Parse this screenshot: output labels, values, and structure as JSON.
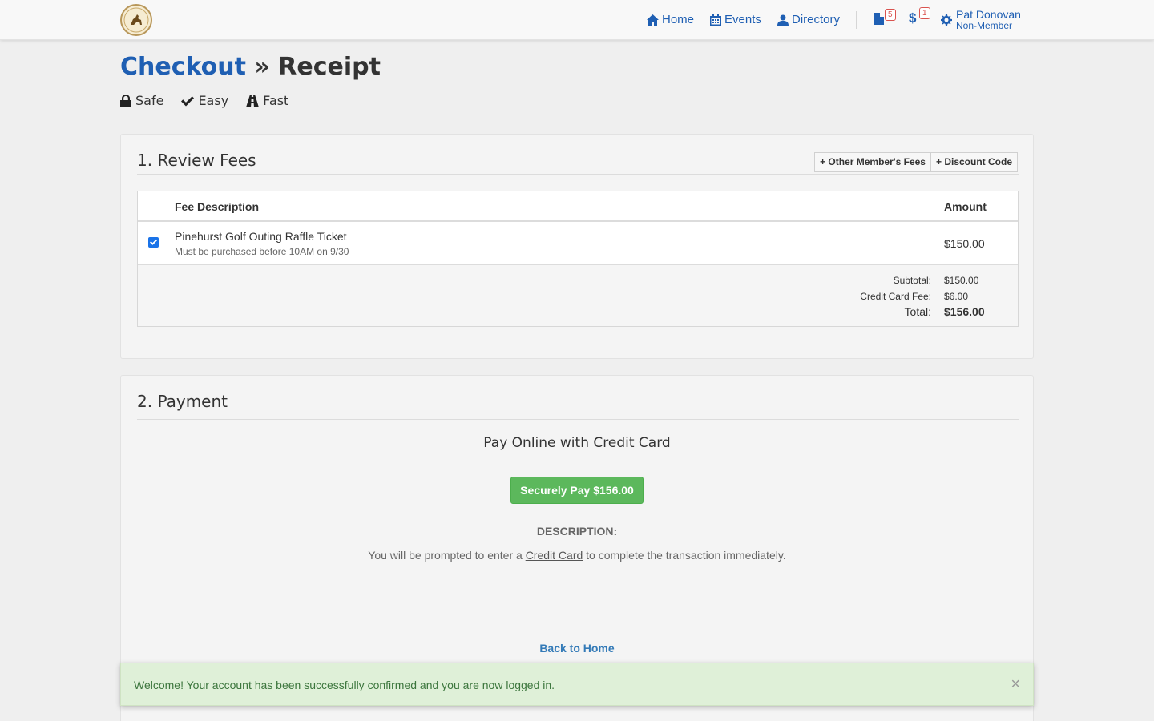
{
  "nav": {
    "logo_icon": "organization-seal-logo",
    "home": "Home",
    "events": "Events",
    "directory": "Directory",
    "documents_badge": "5",
    "payments_badge": "1",
    "payments_symbol": "$",
    "user_name": "Pat Donovan",
    "user_role": "Non-Member",
    "accent_color": "#1f5fb3"
  },
  "header": {
    "link": "Checkout",
    "separator": "»",
    "current": "Receipt"
  },
  "features": {
    "safe": "Safe",
    "easy": "Easy",
    "fast": "Fast"
  },
  "review": {
    "heading": "1. Review Fees",
    "other_fees_button": "+ Other Member's Fees",
    "discount_button": "+ Discount Code",
    "col_description": "Fee Description",
    "col_amount": "Amount",
    "items": [
      {
        "checked": true,
        "name": "Pinehurst Golf Outing Raffle Ticket",
        "note": "Must be purchased before 10AM on  9/30",
        "amount": "$150.00"
      }
    ],
    "subtotal_label": "Subtotal:",
    "subtotal": "$150.00",
    "fee_label": "Credit Card Fee:",
    "fee": "$6.00",
    "total_label": "Total:",
    "total": "$156.00"
  },
  "payment": {
    "heading": "2. Payment",
    "title": "Pay Online with Credit Card",
    "button": "Securely Pay $156.00",
    "button_color": "#5cb85c",
    "description_heading": "DESCRIPTION:",
    "description_pre": "You will be prompted to enter a",
    "description_link": "Credit Card",
    "description_post": "to complete the transaction immediately.",
    "back_link": "Back to Home"
  },
  "alert": {
    "message": "Welcome! Your account has been successfully confirmed and you are now logged in.",
    "close": "×",
    "color": "#dff0d8"
  }
}
